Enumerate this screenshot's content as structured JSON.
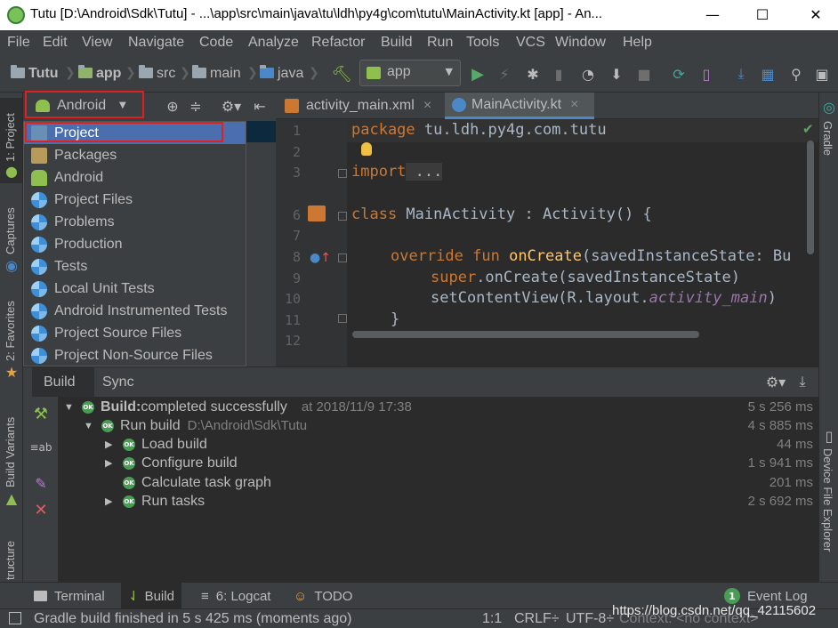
{
  "window": {
    "title": "Tutu [D:\\Android\\Sdk\\Tutu] - ...\\app\\src\\main\\java\\tu\\ldh\\py4g\\com\\tutu\\MainActivity.kt [app] - An...",
    "minimize": "—",
    "maximize": "☐",
    "close": "✕"
  },
  "menu": [
    "File",
    "Edit",
    "View",
    "Navigate",
    "Code",
    "Analyze",
    "Refactor",
    "Build",
    "Run",
    "Tools",
    "VCS",
    "Window",
    "Help"
  ],
  "breadcrumbs": [
    "Tutu",
    "app",
    "src",
    "main",
    "java"
  ],
  "run_config": "app",
  "project_panel": {
    "view_selector": "Android",
    "options": [
      "Project",
      "Packages",
      "Android",
      "Project Files",
      "Problems",
      "Production",
      "Tests",
      "Local Unit Tests",
      "Android Instrumented Tests",
      "Project Source Files",
      "Project Non-Source Files"
    ],
    "selected": "Project"
  },
  "left_strip": [
    "1: Project",
    "Captures",
    "2: Favorites",
    "Build Variants",
    "tructure"
  ],
  "right_strip": [
    "Gradle",
    "Device File Explorer"
  ],
  "editor_tabs": [
    {
      "label": "activity_main.xml",
      "close": "×"
    },
    {
      "label": "MainActivity.kt",
      "close": "×"
    }
  ],
  "editor": {
    "line_numbers": [
      "1",
      "2",
      "3",
      "6",
      "7",
      "8",
      "9",
      "10",
      "11",
      "12"
    ],
    "code": {
      "l1_kw": "package",
      "l1_rest": " tu.ldh.py4g.com.tutu",
      "l3_kw": "import",
      "l3_rest": " ...",
      "l6_kw": "class",
      "l6_rest": " MainActivity : Activity() {",
      "l8_kw1": "override",
      "l8_kw2": " fun ",
      "l8_fn": "onCreate",
      "l8_rest": "(savedInstanceState: Bu",
      "l9_kw": "super",
      "l9_rest": ".onCreate(savedInstanceState)",
      "l10_pre": "setContentView(R.layout.",
      "l10_it": "activity_main",
      "l10_post": ")",
      "l11": "}"
    }
  },
  "build_panel": {
    "tabs": [
      "Build",
      "Sync"
    ],
    "rows": [
      {
        "label_bold": "Build:",
        "label": " completed successfully",
        "detail": "at 2018/11/9 17:38",
        "time": "5 s 256 ms"
      },
      {
        "label": "Run build",
        "detail": "D:\\Android\\Sdk\\Tutu",
        "time": "4 s 885 ms"
      },
      {
        "label": "Load build",
        "time": "44 ms"
      },
      {
        "label": "Configure build",
        "time": "1 s 941 ms"
      },
      {
        "label": "Calculate task graph",
        "time": "201 ms"
      },
      {
        "label": "Run tasks",
        "time": "2 s 692 ms"
      }
    ],
    "ok_badge": "OK"
  },
  "bottom_tabs": {
    "terminal": "Terminal",
    "build": "Build",
    "logcat": "6: Logcat",
    "todo": "TODO",
    "event_log": "Event Log",
    "event_count": "1"
  },
  "status": {
    "message": "Gradle build finished in 5 s 425 ms (moments ago)",
    "position": "1:1",
    "line_sep": "CRLF÷",
    "encoding": "UTF-8÷",
    "context": "Context: <no context>",
    "watermark": "https://blog.csdn.net/qq_42115602"
  }
}
